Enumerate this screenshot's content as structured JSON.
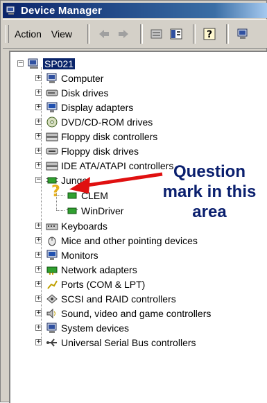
{
  "window": {
    "title": "Device Manager"
  },
  "menu": {
    "action": "Action",
    "view": "View"
  },
  "toolbar": {
    "buttons": [
      "back-icon",
      "forward-icon",
      "properties-icon",
      "show-hide-icon",
      "help-icon",
      "computer-icon"
    ]
  },
  "tree": {
    "root": "SP021",
    "items": [
      {
        "label": "Computer",
        "icon": "computer-icon"
      },
      {
        "label": "Disk drives",
        "icon": "disk-drive-icon"
      },
      {
        "label": "Display adapters",
        "icon": "monitor-icon"
      },
      {
        "label": "DVD/CD-ROM drives",
        "icon": "cdrom-icon"
      },
      {
        "label": "Floppy disk controllers",
        "icon": "controller-icon"
      },
      {
        "label": "Floppy disk drives",
        "icon": "floppy-icon"
      },
      {
        "label": "IDE ATA/ATAPI controllers",
        "icon": "controller-icon"
      },
      {
        "label": "Jungo",
        "icon": "chip-icon",
        "expanded": true,
        "children": [
          {
            "label": "CLEM",
            "icon": "unknown-device-icon"
          },
          {
            "label": "WinDriver",
            "icon": "chip-icon"
          }
        ]
      },
      {
        "label": "Keyboards",
        "icon": "keyboard-icon"
      },
      {
        "label": "Mice and other pointing devices",
        "icon": "mouse-icon"
      },
      {
        "label": "Monitors",
        "icon": "monitor-icon"
      },
      {
        "label": "Network adapters",
        "icon": "network-icon"
      },
      {
        "label": "Ports (COM & LPT)",
        "icon": "port-icon"
      },
      {
        "label": "SCSI and RAID controllers",
        "icon": "scsi-icon"
      },
      {
        "label": "Sound, video and game controllers",
        "icon": "sound-icon"
      },
      {
        "label": "System devices",
        "icon": "computer-icon"
      },
      {
        "label": "Universal Serial Bus controllers",
        "icon": "usb-icon"
      }
    ]
  },
  "annotation": {
    "line1": "Question",
    "line2": "mark in this",
    "line3": "area"
  },
  "colors": {
    "titlebar": "#0a246a",
    "selection": "#0a246a",
    "arrow": "#e01010",
    "annotation": "#0a1f6e"
  }
}
